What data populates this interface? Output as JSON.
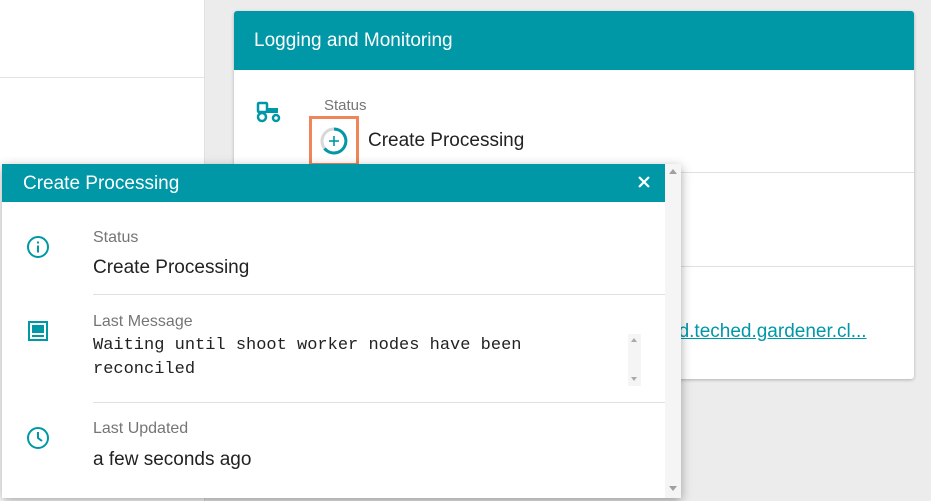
{
  "colors": {
    "accent": "#0097a7",
    "highlight": "#f0845a"
  },
  "card": {
    "title": "Logging and Monitoring",
    "status_label": "Status",
    "status_value": "Create Processing",
    "link_text": "ed.teched.gardener.cl..."
  },
  "popup": {
    "title": "Create Processing",
    "close_icon": "close-icon",
    "status": {
      "label": "Status",
      "value": "Create Processing",
      "icon": "info-icon"
    },
    "last_message": {
      "label": "Last Message",
      "value": "Waiting until shoot worker nodes have been\nreconciled",
      "icon": "message-icon"
    },
    "last_updated": {
      "label": "Last Updated",
      "value": "a few seconds ago",
      "icon": "clock-icon"
    }
  }
}
